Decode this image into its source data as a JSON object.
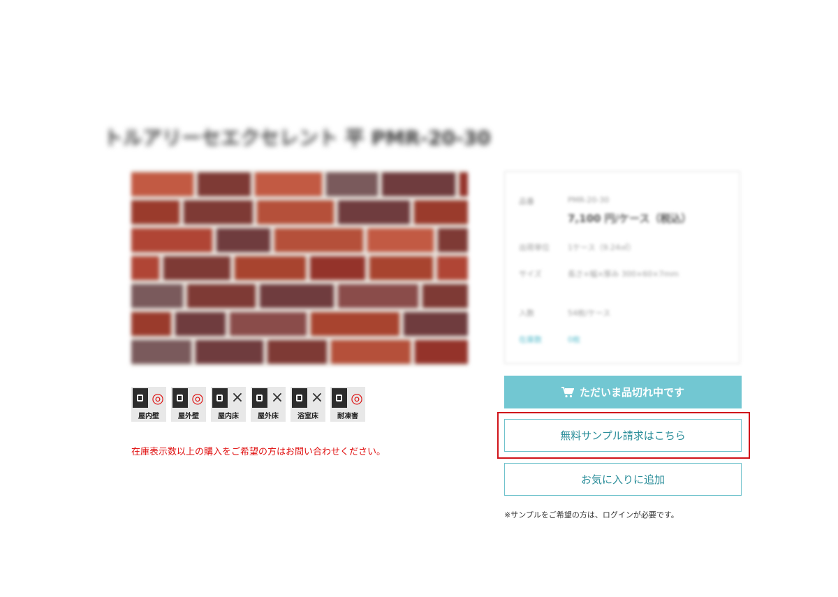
{
  "product": {
    "title": "トルアリーセエクセレント 平 PMR-20-30"
  },
  "info": {
    "rows": [
      {
        "key": "品番",
        "value": "PMR-20-30"
      },
      {
        "key": "",
        "value": "7,100 円/ケース（税込）"
      },
      {
        "key": "出荷単位",
        "value": "1ケース（9.24㎡）"
      },
      {
        "key": "サイズ",
        "value": "長さ×幅×厚み 300×60×7mm"
      },
      {
        "key": "入数",
        "value": "54枚/ケース"
      },
      {
        "key": "在庫数",
        "value": "0枚"
      }
    ]
  },
  "usage_icons": [
    {
      "label": "屋内壁",
      "mark": "◎",
      "status": "ok",
      "icon": "indoor-wall-icon"
    },
    {
      "label": "屋外壁",
      "mark": "◎",
      "status": "ok",
      "icon": "outdoor-wall-icon"
    },
    {
      "label": "屋内床",
      "mark": "×",
      "status": "ng",
      "icon": "indoor-floor-icon"
    },
    {
      "label": "屋外床",
      "mark": "×",
      "status": "ng",
      "icon": "outdoor-floor-icon"
    },
    {
      "label": "浴室床",
      "mark": "×",
      "status": "ng",
      "icon": "bathroom-floor-icon"
    },
    {
      "label": "耐凍害",
      "mark": "◎",
      "status": "ok",
      "icon": "snowflake-icon"
    }
  ],
  "notice": "在庫表示数以上の購入をご希望の方はお問い合わせください。",
  "buttons": {
    "soldout_label": "ただいま品切れ中です",
    "sample_label": "無料サンプル請求はこちら",
    "favorite_label": "お気に入りに追加"
  },
  "login_note": "※サンプルをご希望の方は、ログインが必要です。",
  "colors": {
    "accent": "#72c7d2",
    "accent_text": "#2b8e9a",
    "notice": "#e01010",
    "highlight": "#d0141a"
  }
}
